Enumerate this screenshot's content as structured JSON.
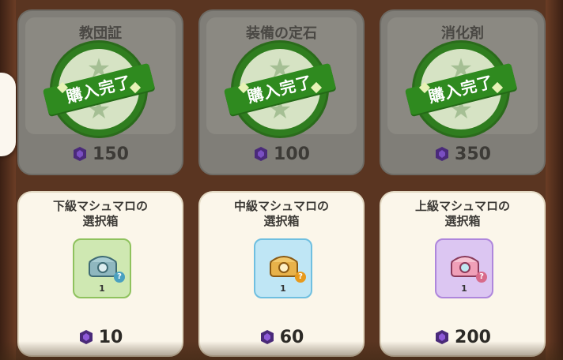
{
  "sold_items": [
    {
      "name": "教団証",
      "price": "150"
    },
    {
      "name": "装備の定石",
      "price": "100"
    },
    {
      "name": "消化剤",
      "price": "350"
    }
  ],
  "stamp_label": "購入完了",
  "shop_items": [
    {
      "title_line1": "下級マシュマロの",
      "title_line2": "選択箱",
      "count": "1",
      "price": "10",
      "box_color": "#cfe8b2",
      "box_border": "#8fc25e"
    },
    {
      "title_line1": "中級マシュマロの",
      "title_line2": "選択箱",
      "count": "1",
      "price": "60",
      "box_color": "#bfe6f5",
      "box_border": "#6fbfe0"
    },
    {
      "title_line1": "上級マシュマロの",
      "title_line2": "選択箱",
      "count": "1",
      "price": "200",
      "box_color": "#dcc6f2",
      "box_border": "#ae86dc"
    }
  ],
  "colors": {
    "gem": "#5b2e9e",
    "stamp_green": "#2f7d1f"
  },
  "icons": {
    "currency": "purple-gem-icon",
    "item": "chest-icon"
  }
}
